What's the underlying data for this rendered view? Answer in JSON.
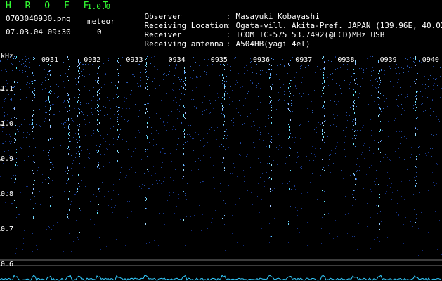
{
  "app": {
    "title": "H R O F F T",
    "version": "1.0.0"
  },
  "file": {
    "name": "0703040930.png",
    "datetime": "07.03.04 09:30"
  },
  "meteor": {
    "label": "meteor",
    "count": "0"
  },
  "meta": {
    "observer": {
      "label": "Observer",
      "value": "Masayuki Kobayashi"
    },
    "location": {
      "label": "Receiving Location",
      "value": "Ogata-vill. Akita-Pref. JAPAN (139.96E, 40.02N)"
    },
    "receiver": {
      "label": "Receiver",
      "value": "ICOM IC-575 53.7492(@LCD)MHz USB"
    },
    "antenna": {
      "label": "Receiving antenna",
      "value": "A504HB(yagi 4el)"
    },
    "separator": ":"
  },
  "spectrogram": {
    "unit": "kHz",
    "freq_labels": [
      "1.1",
      "1.0",
      "0.9",
      "0.8",
      "0.7",
      "0.6"
    ],
    "minute_labels": [
      "0931",
      "0932",
      "0933",
      "0934",
      "0935",
      "0936",
      "0937",
      "0938",
      "0939",
      "0940"
    ],
    "colors": {
      "background": "#000000",
      "signal_low": "#0a1a6e",
      "signal_high": "#3f7bff",
      "trace": "#33ccff",
      "ticks": "#ffffff"
    }
  }
}
